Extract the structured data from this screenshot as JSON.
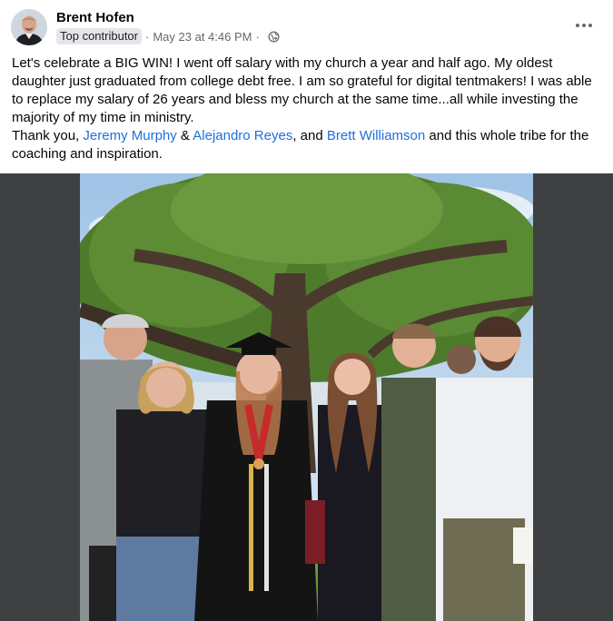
{
  "post": {
    "author": {
      "name": "Brent Hofen",
      "badge": "Top contributor"
    },
    "separator": "·",
    "timestamp": "May 23 at 4:46 PM",
    "privacy_icon": "globe-icon",
    "more_icon": "more-horizontal-icon",
    "body": {
      "paragraph1": "Let's celebrate a BIG WIN! I went off salary with my church a year and half ago. My oldest daughter just graduated from college debt free. I am so grateful for digital tentmakers! I was able to replace my salary of 26 years and bless my church at the same time...all while investing the majority of my time in ministry.",
      "p2_prefix": "Thank you, ",
      "mention1": "Jeremy Murphy",
      "p2_amp": " & ",
      "mention2": "Alejandro Reyes",
      "p2_and": ", and ",
      "mention3": "Brett Williamson",
      "p2_suffix": " and this whole tribe for the coaching and inspiration."
    },
    "photo_icon": "group-graduation-photo"
  },
  "colors": {
    "mention": "#216fdb",
    "meta": "#65676b",
    "badge_bg": "#e4e6eb",
    "photo_frame": "#3e4042"
  }
}
